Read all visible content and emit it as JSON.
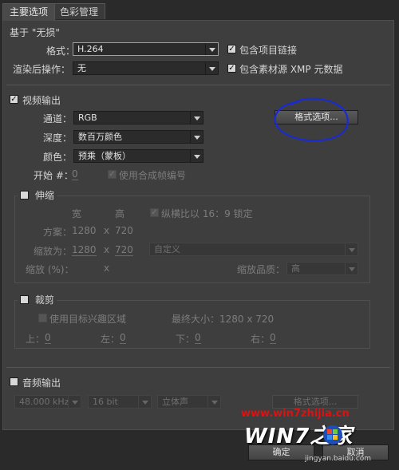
{
  "tabs": [
    {
      "label": "主要选项"
    },
    {
      "label": "色彩管理"
    }
  ],
  "basic": {
    "header": "基于 \"无损\"",
    "format_label": "格式：",
    "format_value": "H.264",
    "post_render_label": "渲染后操作：",
    "post_render_value": "无",
    "include_project_link": "包含项目链接",
    "include_xmp": "包含素材源 XMP 元数据"
  },
  "video": {
    "header": "视频输出",
    "channel_label": "通道：",
    "channel_value": "RGB",
    "depth_label": "深度：",
    "depth_value": "数百万颜色",
    "color_label": "颜色：",
    "color_value": "预乘（蒙板）",
    "format_options_button": "格式选项...",
    "start_label": "开始 #：",
    "start_value": "0",
    "use_comp_frame": "使用合成帧编号"
  },
  "resize": {
    "header": "伸缩",
    "col_width": "宽",
    "col_height": "高",
    "lock_aspect": "纵横比以 16：9 锁定",
    "render_at_label": "方案：",
    "render_w": "1280",
    "render_x": "x",
    "render_h": "720",
    "resize_to_label": "缩放为：",
    "resize_w": "1280",
    "resize_x": "x",
    "resize_h": "720",
    "custom": "自定义",
    "resize_pct_label": "缩放 (%)：",
    "pct_x": "x",
    "quality_label": "缩放品质：",
    "quality_value": "高"
  },
  "crop": {
    "header": "裁剪",
    "use_roi": "使用目标兴趣区域",
    "final_size": "最终大小：1280 x 720",
    "top_label": "上：",
    "top_value": "0",
    "left_label": "左：",
    "left_value": "0",
    "bottom_label": "下：",
    "bottom_value": "0",
    "right_label": "右：",
    "right_value": "0"
  },
  "audio": {
    "header": "音频输出",
    "rate": "48.000 kHz",
    "bits": "16 bit",
    "channels": "立体声",
    "format_options_button": "格式选项..."
  },
  "footer": {
    "ok": "确定",
    "cancel": "取消"
  },
  "watermark": {
    "url": "www.win7zhijia.cn",
    "logo_text": "WIN7之家",
    "sub": "jingyan.baidu.com"
  },
  "colors": {
    "panel_bg": "#3e3e3e",
    "highlight_border": "#d79b22",
    "annotation": "#1a2bd0",
    "watermark_red": "#e01010"
  }
}
